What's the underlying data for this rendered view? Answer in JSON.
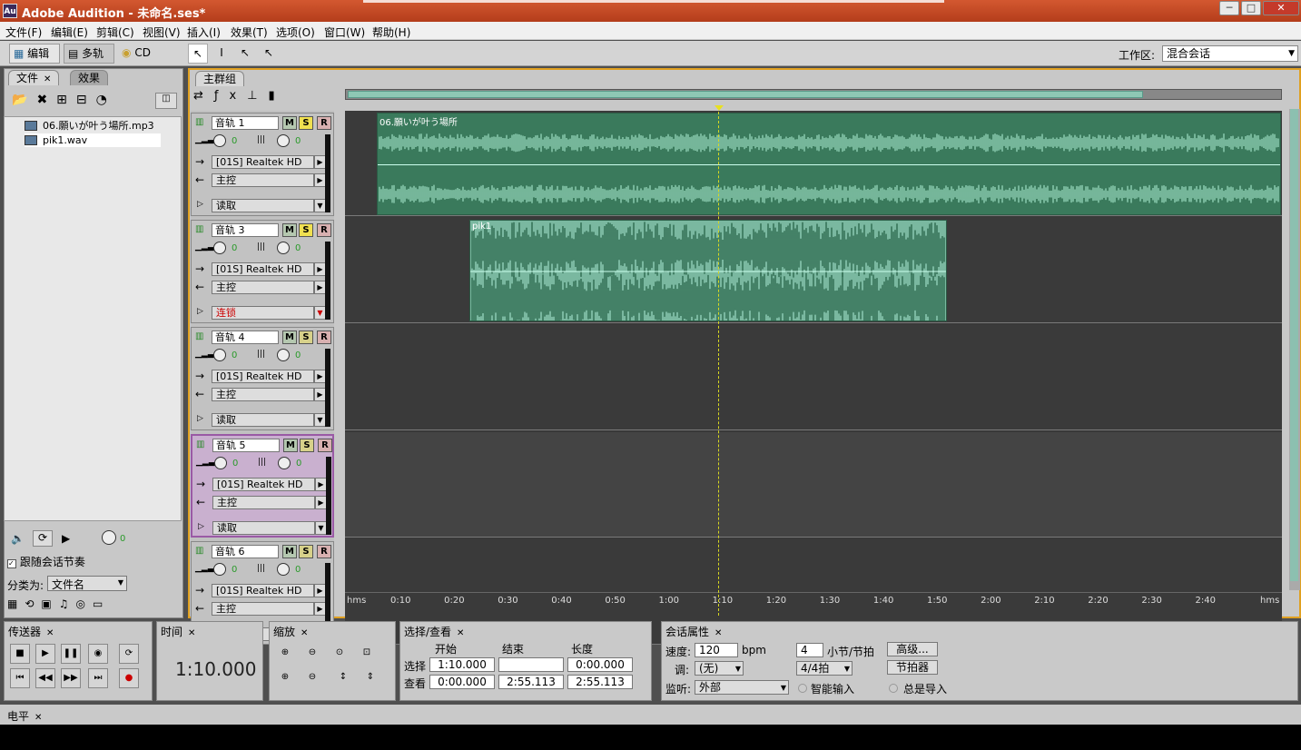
{
  "window": {
    "app_icon": "Au",
    "title": "Adobe Audition - 未命名.ses*"
  },
  "menu": [
    "文件(F)",
    "编辑(E)",
    "剪辑(C)",
    "视图(V)",
    "插入(I)",
    "效果(T)",
    "选项(O)",
    "窗口(W)",
    "帮助(H)"
  ],
  "toolbar": {
    "edit_label": "编辑",
    "multitrack_label": "多轨",
    "cd_label": "CD",
    "workspace_label": "工作区:",
    "workspace_value": "混合会话"
  },
  "left_panel": {
    "tab_files": "文件",
    "tab_effects": "效果",
    "files": [
      "06.願いが叶う場所.mp3",
      "pik1.wav"
    ],
    "vol_value": "0",
    "follow_label": "跟随会话节奏",
    "sort_label": "分类为:",
    "sort_value": "文件名"
  },
  "main_panel": {
    "tab": "主群组"
  },
  "tracks": [
    {
      "name": "音轨 1",
      "vol": "0",
      "pan": "0",
      "out": "[01S] Realtek HD",
      "bus": "主控",
      "auto": "读取",
      "solo": true
    },
    {
      "name": "音轨 3",
      "vol": "0",
      "pan": "0",
      "out": "[01S] Realtek HD",
      "bus": "主控",
      "auto": "连锁",
      "solo": true
    },
    {
      "name": "音轨 4",
      "vol": "0",
      "pan": "0",
      "out": "[01S] Realtek HD",
      "bus": "主控",
      "auto": "读取",
      "solo": false
    },
    {
      "name": "音轨 5",
      "vol": "0",
      "pan": "0",
      "out": "[01S] Realtek HD",
      "bus": "主控",
      "auto": "读取",
      "solo": false
    },
    {
      "name": "音轨 6",
      "vol": "0",
      "pan": "0",
      "out": "[01S] Realtek HD",
      "bus": "主控",
      "auto": "读取",
      "solo": false
    }
  ],
  "clips": {
    "clip1": "06.願いが叶う場所",
    "clip2": "pik1"
  },
  "ruler": [
    "hms",
    "0:10",
    "0:20",
    "0:30",
    "0:40",
    "0:50",
    "1:00",
    "1:10",
    "1:20",
    "1:30",
    "1:40",
    "1:50",
    "2:00",
    "2:10",
    "2:20",
    "2:30",
    "2:40",
    "hms"
  ],
  "transport": {
    "tab": "传送器"
  },
  "time": {
    "tab": "时间",
    "value": "1:10.000"
  },
  "zoom": {
    "tab": "缩放"
  },
  "selection": {
    "tab": "选择/查看",
    "col_start": "开始",
    "col_end": "结束",
    "col_len": "长度",
    "row_sel": "选择",
    "row_view": "查看",
    "sel_start": "1:10.000",
    "sel_end": "",
    "sel_len": "0:00.000",
    "view_start": "0:00.000",
    "view_end": "2:55.113",
    "view_len": "2:55.113"
  },
  "session": {
    "tab": "会话属性",
    "tempo_label": "速度:",
    "tempo": "120",
    "bpm": "bpm",
    "beats": "4",
    "beats_label": "小节/节拍",
    "advanced": "高级...",
    "key_label": "调:",
    "key": "(无)",
    "sig": "4/4拍",
    "metronome": "节拍器",
    "monitor_label": "监听:",
    "monitor": "外部",
    "smart_input": "智能输入",
    "always_import": "总是导入"
  },
  "meter": {
    "tab": "电平"
  }
}
